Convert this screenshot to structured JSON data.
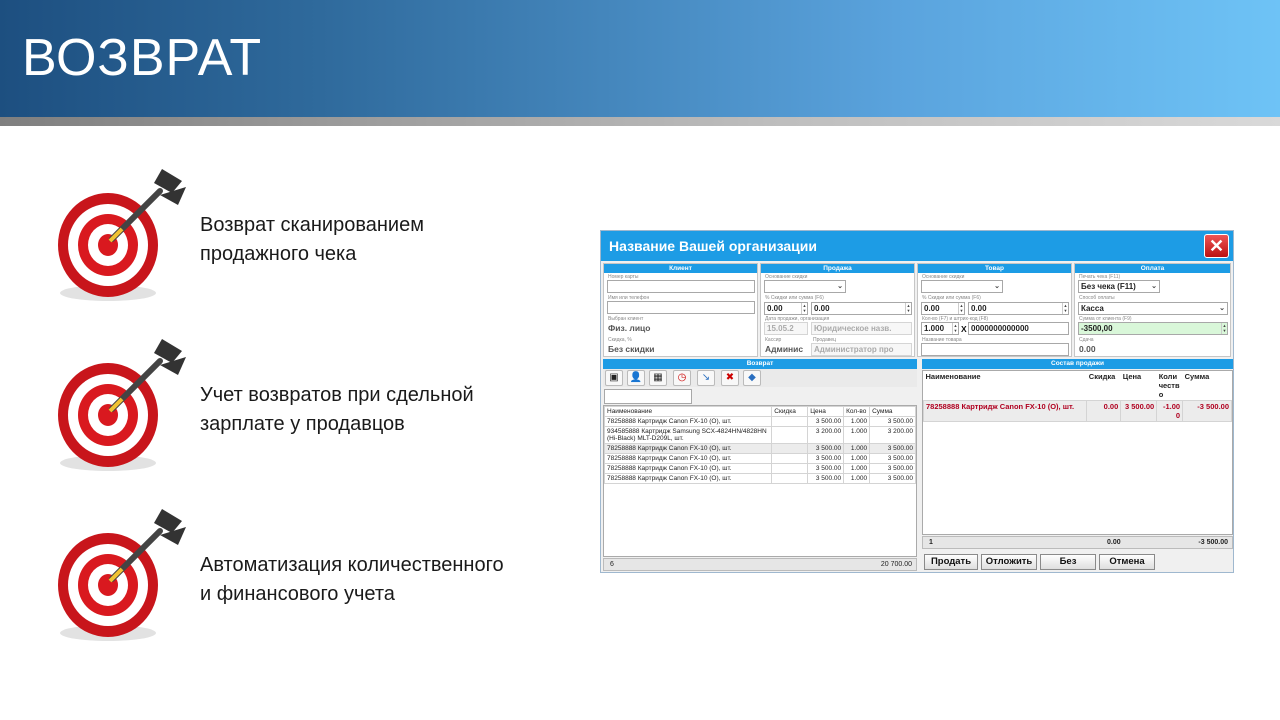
{
  "slide": {
    "title": "ВОЗВРАТ",
    "bullets": [
      {
        "line1": "Возврат сканированием",
        "line2": "продажного чека"
      },
      {
        "line1": "Учет возвратов при сдельной",
        "line2": "зарплате у продавцов"
      },
      {
        "line1": "Автоматизация количественного",
        "line2": "и финансового учета"
      }
    ],
    "bullet_icon": "dartboard-target-icon"
  },
  "app": {
    "title": "Название Вашей организации",
    "close_icon": "close-icon",
    "colors": {
      "accent": "#1d9ce5",
      "close": "#cc2222",
      "negative": "#b00020",
      "highlight": "#d9f7d9"
    },
    "client": {
      "header": "Клиент",
      "card_label": "Номер карты",
      "card_value": "",
      "phone_label": "Имя или телефон",
      "phone_value": "",
      "chosen_label": "Выбран клиент",
      "chosen_value": "Физ. лицо",
      "discount_label": "Скидка, %",
      "discount_value": "Без скидки"
    },
    "sale": {
      "header": "Продажа",
      "reason_label": "Основание скидки",
      "reason_value": "",
      "pct_label": "% Скидки или сумма (F6)",
      "pct_value": "0.00",
      "sum_value": "0.00",
      "date_label": "Дата продажи, организация",
      "date_value": "15.05.2",
      "org_value": "Юридическое назв.",
      "cashier_label": "Кассир",
      "cashier_value": "Админис",
      "seller_label": "Продавец",
      "seller_value": "Администратор про"
    },
    "product": {
      "header": "Товар",
      "reason_label": "Основание скидки",
      "reason_value": "",
      "pct_label": "% Скидки или сумма (F6)",
      "pct_value": "0.00",
      "sum_value": "0.00",
      "qty_label": "Кол-во (F7) и штрих-код (F8)",
      "qty_value": "1.000",
      "times": "X",
      "barcode_value": "0000000000000",
      "name_label": "Название товара",
      "name_value": ""
    },
    "payment": {
      "header": "Оплата",
      "print_label": "Печать чека (F11)",
      "print_value": "Без чека (F11)",
      "method_label": "Способ оплаты",
      "method_value": "Касса",
      "client_sum_label": "Сумма от клиента (F9)",
      "client_sum_value": "-3500,00",
      "change_label": "Сдача",
      "change_value": "0.00"
    },
    "returns": {
      "header": "Возврат",
      "toolbar_icons": [
        "image-icon",
        "user-icon",
        "box-icon",
        "clock-icon",
        "arrow-icon",
        "delete-icon",
        "tag-icon"
      ],
      "columns": [
        "Наименование",
        "Скидка",
        "Цена",
        "Кол-во",
        "Сумма"
      ],
      "rows": [
        [
          "78258888 Картридж Canon FX-10 (O), шт.",
          "",
          "3 500.00",
          "1.000",
          "3 500.00"
        ],
        [
          "934585888 Картридж Samsung SCX-4824HN/4828HN (Hi-Black) MLT-D209L, шт.",
          "",
          "3 200.00",
          "1.000",
          "3 200.00"
        ],
        [
          "78258888 Картридж Canon FX-10 (O), шт.",
          "",
          "3 500.00",
          "1.000",
          "3 500.00"
        ],
        [
          "78258888 Картридж Canon FX-10 (O), шт.",
          "",
          "3 500.00",
          "1.000",
          "3 500.00"
        ],
        [
          "78258888 Картридж Canon FX-10 (O), шт.",
          "",
          "3 500.00",
          "1.000",
          "3 500.00"
        ],
        [
          "78258888 Картридж Canon FX-10 (O), шт.",
          "",
          "3 500.00",
          "1.000",
          "3 500.00"
        ]
      ],
      "footer_count": "6",
      "footer_total": "20 700.00"
    },
    "sale_items": {
      "header": "Состав продажи",
      "columns": [
        "Наименование",
        "Скидка",
        "Цена",
        "Количество",
        "Сумма"
      ],
      "rows": [
        [
          "78258888 Картридж Canon FX-10 (O), шт.",
          "0.00",
          "3 500.00",
          "-1.000",
          "-3 500.00"
        ]
      ],
      "footer_count": "1",
      "footer_discount": "0.00",
      "footer_total": "-3 500.00"
    },
    "buttons": {
      "sell": "Продать",
      "postpone": "Отложить",
      "without": "Без",
      "cancel": "Отмена"
    }
  }
}
